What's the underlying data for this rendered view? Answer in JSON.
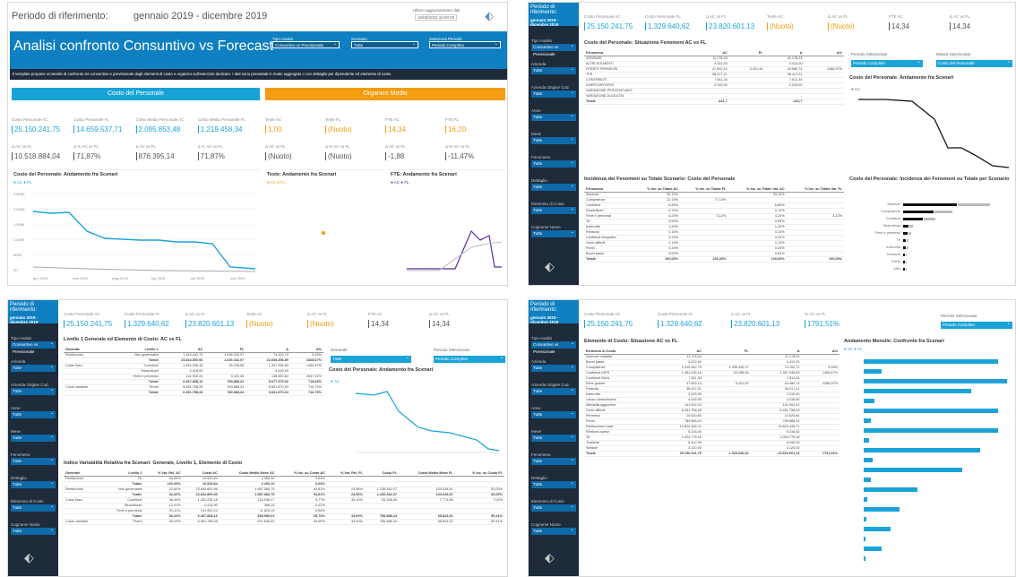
{
  "p1": {
    "period_label": "Periodo di riferimento:",
    "period_value": "gennaio 2019 - dicembre 2019",
    "update_label": "Ultimo aggiornamento dati",
    "update_value": "16/03/2023 15:00:00",
    "banner_title": "Analisi confronto Consuntivo vs Forecast",
    "tipo_label": "Tipo Analisi",
    "tipo_value": "Consuntivo vs Previsionale",
    "scenario_label": "Scenario",
    "scenario_value": "Tutte",
    "periodo_label": "Seleziona Periodo",
    "periodo_value": "Periodo Completo",
    "description": "Il template propone un'analisi di confronto tra consuntivo e previsionale degli elementi di costo e organico sull'esercizio dedicato. I dati sono presentati in modo aggregato o con dettaglio per dipendente ed elemento di costo.",
    "section_costo": "Costo del Personale",
    "section_organico": "Organico Medio",
    "kpis_costo": [
      {
        "label": "Costo Personale AC",
        "value": "25.150.241,75"
      },
      {
        "label": "Costo Personale FL",
        "value": "14.659.537,71"
      },
      {
        "label": "Costo Medio Personale AC",
        "value": "2.095.853,48"
      },
      {
        "label": "Costo Medio Personale FL",
        "value": "1.219.458,34"
      },
      {
        "label": "Δ AC vs FL",
        "value": "10.518.884,04"
      },
      {
        "label": "Δ % AC vs FL",
        "value": "71,87%"
      },
      {
        "label": "Δ AC vs FL",
        "value": "876.395,14"
      },
      {
        "label": "Δ % AC vs FL",
        "value": "71,87%"
      }
    ],
    "kpis_org": [
      {
        "label": "Teste AC",
        "value": "1,00"
      },
      {
        "label": "Teste FL",
        "value": "(Nuoto)"
      },
      {
        "label": "FTE AC",
        "value": "14,34"
      },
      {
        "label": "FTE FL",
        "value": "16,20"
      },
      {
        "label": "Δ AC vs FL",
        "value": "(Nuoto)"
      },
      {
        "label": "Δ % AC vs FL",
        "value": "(Nuoto)"
      },
      {
        "label": "Δ AC vs FL",
        "value": "-1,88"
      },
      {
        "label": "Δ % AC vs FL",
        "value": "-11,47%"
      }
    ],
    "chart1_title": "Costo del Personale: Andamento fra Scenari",
    "chart2_title": "Teste: Andamento fra Scenari",
    "chart3_title": "FTE: Andamento fra Scenari",
    "chart1_yticks": [
      "2.500K",
      "2.000K",
      "1.500K",
      "1.000K",
      "500K",
      "0K"
    ],
    "chart1_xticks": [
      "gen 2019",
      "mar 2019",
      "mag 2019",
      "lug 2019",
      "set 2019",
      "nov 2019"
    ]
  },
  "sidebar": {
    "period_label": "Periodo di riferimento:",
    "period_value": "gennaio 2019 - dicembre 2019",
    "filters": [
      {
        "label": "Tipo Analisi",
        "value": "Consuntivo vs Previsionale"
      },
      {
        "label": "Azienda",
        "value": "Tutte"
      },
      {
        "label": "Azienda Origine Cod.",
        "value": "Tutte"
      },
      {
        "label": "Anno",
        "value": "Tutte"
      },
      {
        "label": "Mese",
        "value": "Tutte"
      },
      {
        "label": "Fenomeno",
        "value": "Tutte"
      },
      {
        "label": "Dettaglio",
        "value": "Tutte"
      },
      {
        "label": "Elemento di Costo",
        "value": "Tutte"
      },
      {
        "label": "Cognome Nome",
        "value": "Tutte"
      }
    ]
  },
  "kpi_strip": [
    {
      "label": "Costo Personale AC",
      "value": "25.150.241,75"
    },
    {
      "label": "Costo Personale FL",
      "value": "1.329.640,62"
    },
    {
      "label": "Δ AC vs FL",
      "value": "23.820.601,13"
    },
    {
      "label": "Teste AC",
      "value": "(Nuoto)"
    },
    {
      "label": "Δ AC vs FL",
      "value": "(Nuoto)"
    },
    {
      "label": "FTE AC",
      "value": "14,34"
    },
    {
      "label": "Δ AC vs FL",
      "value": "14,34"
    }
  ],
  "p2": {
    "table1_title": "Costo del Personale: Situazione Fenomeni AC vs FL",
    "table1_cols": [
      "Fenomeno",
      "AC",
      "FL",
      "Δ",
      "Δ%"
    ],
    "table1_rows": [
      [
        "ASSENZE",
        "11.178,24",
        "",
        "11.178,24",
        ""
      ],
      [
        "ALTRI ELEMENTI",
        "4.412,00",
        "",
        "4.412,00",
        ""
      ],
      [
        "FERIE E PERMESSI",
        "47.502,14",
        "3.421,40",
        "44.080,74",
        "1288,37%"
      ],
      [
        "TFR",
        "38.417,21",
        "",
        "38.417,21",
        ""
      ],
      [
        "CONTRIBUTI",
        "7.811,34",
        "",
        "7.811,34",
        ""
      ],
      [
        "ONERI DIFFERITI",
        "2.315,00",
        "",
        "2.315,00",
        ""
      ],
      [
        "VARIAZIONE PERCENTUALE",
        "-",
        "",
        "-",
        ""
      ],
      [
        "VARIAZIONE ALIQUOTA",
        "-",
        "",
        "-",
        ""
      ],
      [
        "Totale",
        "-441,7",
        "",
        "-441,7",
        ""
      ]
    ],
    "dd1_label": "Periodo Selezionato",
    "dd1_value": "Periodo Completo",
    "dd2_label": "Misura Selezionata",
    "dd2_value": "Costo del Personale",
    "chart_title": "Costo del Personale: Andamento fra Scenari",
    "table2_title": "Incidenza dei Fenomeni su Totale Scenario: Costo del Personale",
    "table2_cols": [
      "Fenomeno",
      "% Inc. su Totale AC",
      "% Inc. su Totale FL",
      "% Inc. su Totale Var. AC",
      "% Inc. su Totale Var. FL"
    ],
    "table2_rows": [
      [
        "Assenze",
        "30,10%",
        "",
        "33,10%",
        ""
      ],
      [
        "Competenze",
        "22,15%",
        "77,10%",
        "",
        ""
      ],
      [
        "Contributi",
        "6,84%",
        "",
        "6,84%",
        ""
      ],
      [
        "Straordinari",
        "0,70%",
        "",
        "0,70%",
        ""
      ],
      [
        "Ferie e permessi",
        "4,23%",
        "3,12%",
        "4,23%",
        "3,12%"
      ],
      [
        "Tfr",
        "0,50%",
        "",
        "0,50%",
        ""
      ],
      [
        "Indennità",
        "1,20%",
        "",
        "1,20%",
        ""
      ],
      [
        "Rimborsi",
        "0,10%",
        "",
        "0,10%",
        ""
      ],
      [
        "Contributi integrativi",
        "3,31%",
        "",
        "3,31%",
        ""
      ],
      [
        "Oneri differiti",
        "1,14%",
        "",
        "1,14%",
        ""
      ],
      [
        "Premi",
        "0,34%",
        "",
        "0,34%",
        ""
      ],
      [
        "Buoni pasto",
        "0,62%",
        "",
        "0,62%",
        ""
      ],
      [
        "Totale",
        "100,00%",
        "100,00%",
        "100,00%",
        "100,00%"
      ]
    ],
    "bar_title": "Costo del Personale: Incidenza dei Fenomeni su Totale per Scenario",
    "bar_labels": [
      "Assenze",
      "Competenze",
      "Contributi",
      "Straordinari",
      "Ferie e permessi",
      "Tfr",
      "Indennità",
      "Rimborsi",
      "Premi",
      "Altro"
    ]
  },
  "p3": {
    "table1_title": "Livello 1 Generale ed Elemento di Costo: AC vs FL",
    "table1_cols": [
      "Generale",
      "Livello 1",
      "AC",
      "FL",
      "Δ",
      "Δ%"
    ],
    "table1_rows": [
      [
        "Retribuzioni",
        "Non governabili",
        "1.310.442,79",
        "1.236.342,07",
        "74.100,72",
        "5,99%"
      ],
      [
        "",
        "Totale",
        "23.844.800,96",
        "1.236.342,07",
        "22.608.458,89",
        "1828,67%"
      ],
      [
        "Costo fisso",
        "Contributi",
        "1.451.235,18",
        "93.298,55",
        "1.357.936,63",
        "1455,47%"
      ],
      [
        "",
        "Straordinari",
        "4.418,90",
        "",
        "4.418,90",
        ""
      ],
      [
        "",
        "Ferie e permessi",
        "141.902,24",
        "3.421,40",
        "138.480,84",
        "4047,51%"
      ],
      [
        "",
        "Totale",
        "6.467.868,16",
        "789.888,24",
        "5.677.979,92",
        "718,83%"
      ],
      [
        "Costo variabile",
        "Premi",
        "6.451.758,28",
        "789.888,24",
        "5.661.870,04",
        "716,79%"
      ],
      [
        "",
        "Totale",
        "6.451.758,28",
        "789.888,24",
        "5.661.870,04",
        "716,79%"
      ]
    ],
    "dd1_label": "Generale",
    "dd1_value": "Tutte",
    "dd2_label": "Periodo Selezionato",
    "dd2_value": "Periodo Completo",
    "chart_title": "Costo del Personale: Andamento fra Scenari",
    "table2_title": "Indice Variabilità Relativa fra Scenari: Generale, Livello 1, Elemento di Costo",
    "table2_cols": [
      "Generale",
      "Livello 1",
      "% Var. Rel. AC",
      "Costo AC",
      "Costo Medio Mese AC",
      "% Inc. su Costo AC",
      "% Var. Rel. FL",
      "Costo FL",
      "Costo Medio Mese FL",
      "% Inc. su Costo FL"
    ],
    "table2_rows": [
      [
        "Retribuzioni",
        "Tfr",
        "34,09%",
        "10.520,84",
        "2.260,10",
        "0,04%",
        "",
        "",
        "",
        ""
      ],
      [
        "",
        "Totale",
        "100,00%",
        "10.520,84",
        "2.260,10",
        "0,04%",
        "",
        "",
        "",
        ""
      ],
      [
        "Retribuzioni",
        "Non governabili",
        "32,62%",
        "23.844.800,96",
        "1.987.066,75",
        "94,81%",
        "23,56%",
        "1.236.342,07",
        "103.028,51",
        "93,00%"
      ],
      [
        "",
        "Totale",
        "32,62%",
        "23.844.800,96",
        "1.987.066,75",
        "94,81%",
        "23,56%",
        "1.236.342,07",
        "103.028,51",
        "93,00%"
      ],
      [
        "Costo fisso",
        "Contributi",
        "38,44%",
        "1.451.235,18",
        "120.936,27",
        "5,77%",
        "35,10%",
        "93.298,55",
        "7.774,88",
        "7,02%"
      ],
      [
        "",
        "Straordinari",
        "12,41%",
        "4.418,90",
        "368,24",
        "0,02%",
        "",
        "",
        "",
        ""
      ],
      [
        "",
        "Ferie e permessi",
        "20,11%",
        "141.902,24",
        "11.825,19",
        "0,56%",
        "",
        "",
        "",
        ""
      ],
      [
        "",
        "Totale",
        "36,22%",
        "6.467.868,16",
        "538.989,01",
        "25,72%",
        "33,00%",
        "789.888,24",
        "65.824,02",
        "59,41%"
      ],
      [
        "Costo variabile",
        "Premi",
        "36,22%",
        "6.451.758,28",
        "537.646,52",
        "25,65%",
        "33,00%",
        "789.888,24",
        "65.824,02",
        "59,41%"
      ]
    ]
  },
  "p4": {
    "kpi_strip": [
      {
        "label": "Costo Personale AC",
        "value": "25.150.241,75"
      },
      {
        "label": "Costo Personale FL",
        "value": "1.329.640,62"
      },
      {
        "label": "Δ AC vs FL",
        "value": "23.820.601,13"
      },
      {
        "label": "% AC vs FL",
        "value": "1791,51%"
      }
    ],
    "dd_label": "Periodo Selezionato",
    "dd_value": "Periodo Completo",
    "table_title": "Elemento di Costo: Situazione AC vs FL",
    "table_cols": [
      "Elemento di Costo",
      "AC",
      "FL",
      "Δ",
      "Δ%"
    ],
    "table_rows": [
      [
        "Assenze malattia",
        "11.178,24",
        "",
        "11.178,24",
        ""
      ],
      [
        "Buoni pasto",
        "4.412,00",
        "",
        "4.412,00",
        ""
      ],
      [
        "Competenze",
        "1.310.442,79",
        "1.236.342,07",
        "74.100,72",
        "5,99%"
      ],
      [
        "Contributi INPS",
        "1.451.235,18",
        "93.298,55",
        "1.357.936,63",
        "1455,47%"
      ],
      [
        "Contributi INAIL",
        "7.811,34",
        "",
        "7.811,34",
        ""
      ],
      [
        "Ferie godute",
        "47.502,14",
        "3.421,40",
        "44.080,74",
        "1288,37%"
      ],
      [
        "Festività",
        "38.417,21",
        "",
        "38.417,21",
        ""
      ],
      [
        "Indennità",
        "2.315,00",
        "",
        "2.315,00",
        ""
      ],
      [
        "Lavoro straordinario",
        "4.418,90",
        "",
        "4.418,90",
        ""
      ],
      [
        "Mensilità aggiuntive",
        "141.902,24",
        "",
        "141.902,24",
        ""
      ],
      [
        "Oneri differiti",
        "6.451.758,28",
        "",
        "6.451.758,28",
        ""
      ],
      [
        "Permessi",
        "10.520,84",
        "",
        "10.520,84",
        ""
      ],
      [
        "Premi",
        "789.888,24",
        "",
        "789.888,24",
        ""
      ],
      [
        "Retribuzione base",
        "13.822.445,71",
        "",
        "13.822.445,71",
        ""
      ],
      [
        "Rimborsi spese",
        "5.218,40",
        "",
        "5.218,40",
        ""
      ],
      [
        "Tfr",
        "1.023.776,18",
        "",
        "1.023.776,18",
        ""
      ],
      [
        "Trasferte",
        "8.442,90",
        "",
        "8.442,90",
        ""
      ],
      [
        "Welfare",
        "3.120,00",
        "",
        "3.120,00",
        ""
      ],
      [
        "Totale",
        "25.150.241,75",
        "1.329.640,62",
        "23.820.601,13",
        "1791,51%"
      ]
    ],
    "chart_title": "Andamento Mensile: Confronto fra Scenari"
  }
}
